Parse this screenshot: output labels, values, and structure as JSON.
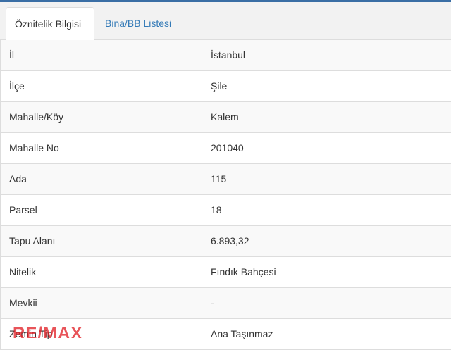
{
  "tabs": [
    {
      "label": "Öznitelik Bilgisi",
      "active": true
    },
    {
      "label": "Bina/BB Listesi",
      "active": false
    }
  ],
  "rows": [
    {
      "label": "İl",
      "value": "İstanbul"
    },
    {
      "label": "İlçe",
      "value": "Şile"
    },
    {
      "label": "Mahalle/Köy",
      "value": "Kalem"
    },
    {
      "label": "Mahalle No",
      "value": "201040"
    },
    {
      "label": "Ada",
      "value": "115"
    },
    {
      "label": "Parsel",
      "value": "18"
    },
    {
      "label": "Tapu Alanı",
      "value": "6.893,32"
    },
    {
      "label": "Nitelik",
      "value": "Fındık Bahçesi"
    },
    {
      "label": "Mevkii",
      "value": "-"
    },
    {
      "label": "Zemin Tip",
      "value": "Ana Taşınmaz"
    }
  ],
  "watermark": {
    "text": "RE/MAX"
  },
  "colors": {
    "accent": "#3a6ea5",
    "link": "#337ab7",
    "watermark": "#e11b22"
  }
}
